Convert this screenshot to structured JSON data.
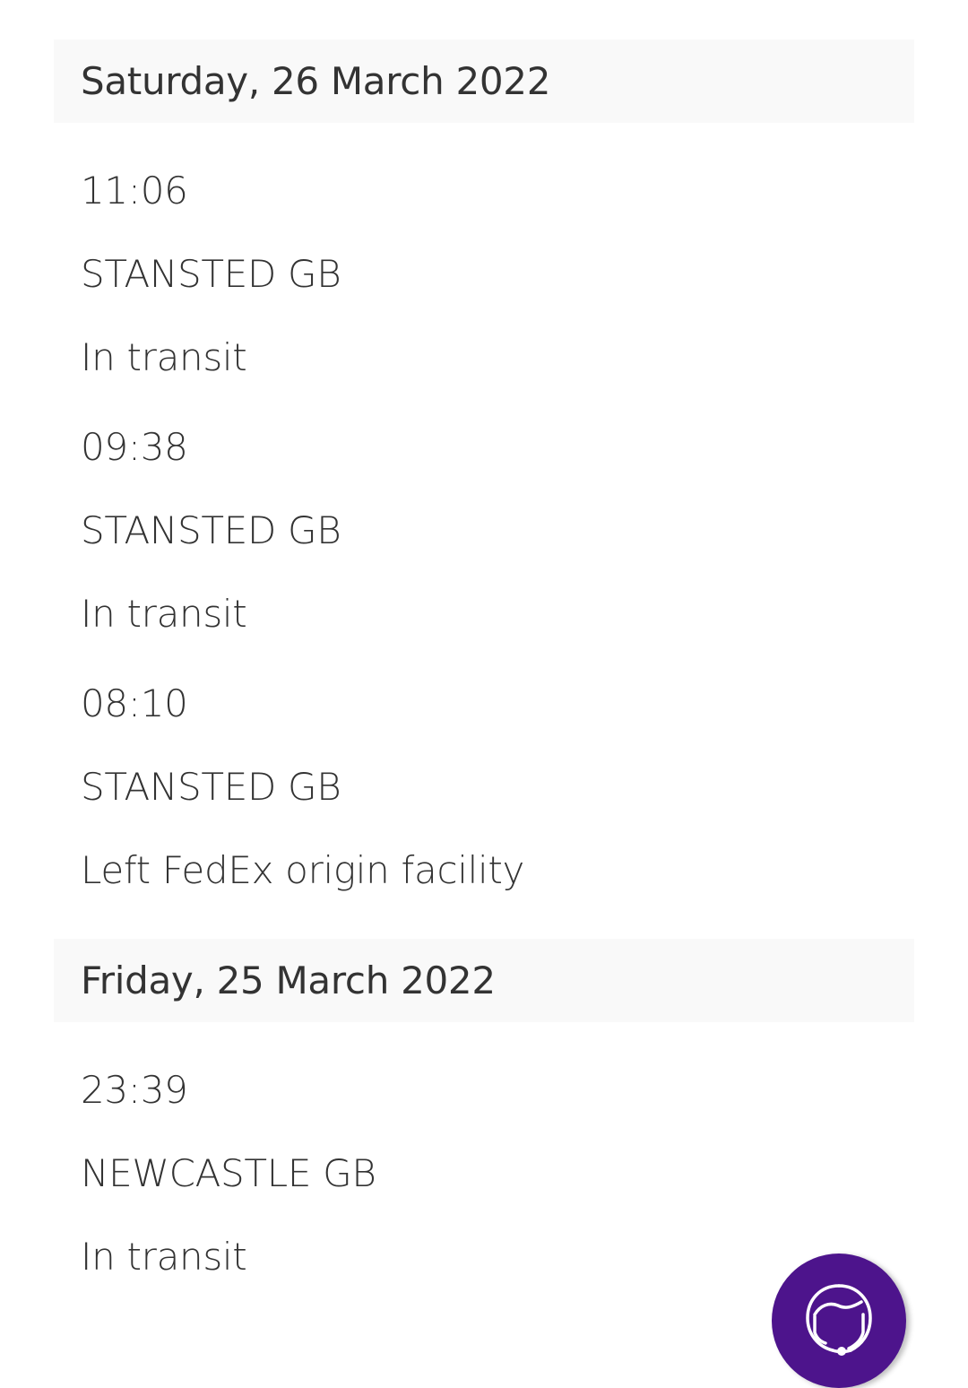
{
  "tracking": {
    "groups": [
      {
        "date": "Saturday, 26 March 2022",
        "events": [
          {
            "time": "11:06",
            "location": "STANSTED GB",
            "status": "In transit"
          },
          {
            "time": "09:38",
            "location": "STANSTED GB",
            "status": "In transit"
          },
          {
            "time": "08:10",
            "location": "STANSTED GB",
            "status": "Left FedEx origin facility"
          }
        ]
      },
      {
        "date": "Friday, 25 March 2022",
        "events": [
          {
            "time": "23:39",
            "location": "NEWCASTLE GB",
            "status": "In transit"
          }
        ]
      }
    ]
  },
  "chat_button": {
    "icon": "headset-agent-icon",
    "color": "#4d148c"
  }
}
